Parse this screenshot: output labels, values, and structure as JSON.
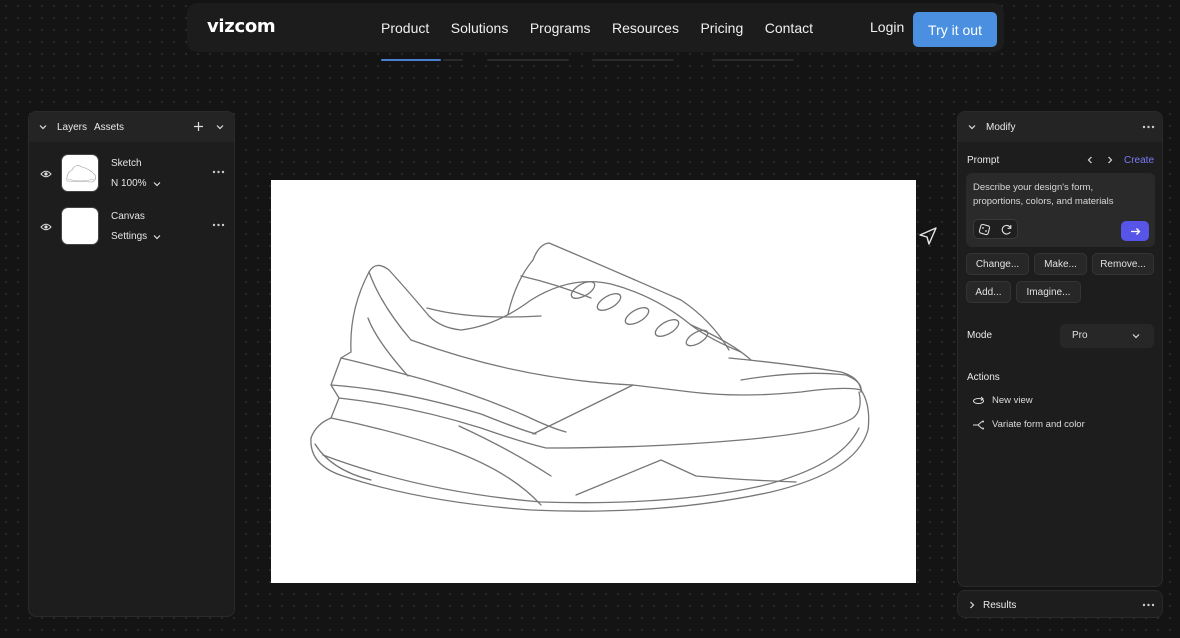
{
  "nav": {
    "logo": "vizcom",
    "links": [
      "Product",
      "Solutions",
      "Programs",
      "Resources",
      "Pricing",
      "Contact"
    ],
    "login": "Login",
    "cta": "Try it out"
  },
  "left_panel": {
    "tabs": [
      "Layers",
      "Assets"
    ],
    "layers": [
      {
        "name": "Sketch",
        "sub": "N 100%"
      },
      {
        "name": "Canvas",
        "sub": "Settings"
      }
    ]
  },
  "right_panel": {
    "title": "Modify",
    "prompt_label": "Prompt",
    "create_label": "Create",
    "prompt_placeholder": "Describe your design's form, proportions, colors, and materials",
    "chips": [
      "Change...",
      "Make...",
      "Remove...",
      "Add...",
      "Imagine..."
    ],
    "mode_label": "Mode",
    "mode_value": "Pro",
    "actions_label": "Actions",
    "actions": [
      "New view",
      "Variate form and color"
    ],
    "results_label": "Results"
  },
  "colors": {
    "accent_blue": "#4a8fe0",
    "send_purple": "#5655e8",
    "create_link": "#7b7bf5"
  }
}
